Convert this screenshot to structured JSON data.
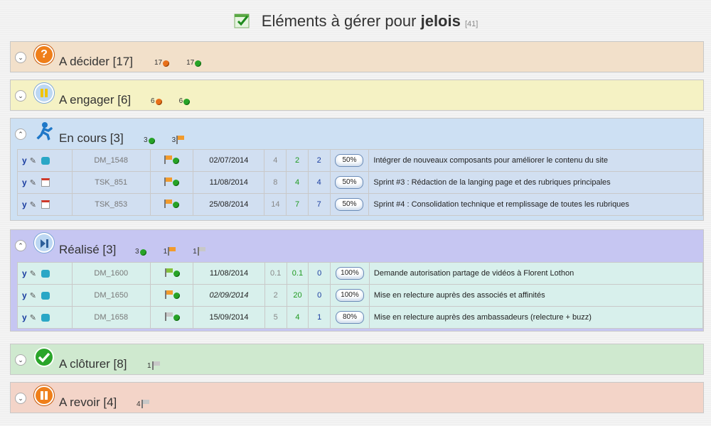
{
  "title": {
    "prefix": "Eléments à gérer pour",
    "user": "jelois",
    "count": "[41]"
  },
  "colors": {
    "decider": "#f2e0ca",
    "engager": "#f5f2c4",
    "encours": "#cde0f3",
    "realise": "#c6c6f2",
    "cloturer": "#cfe9cf",
    "revoir": "#f3d4c8"
  },
  "sections": {
    "decider": {
      "label": "A décider [17]",
      "badges": [
        "17",
        "17"
      ]
    },
    "engager": {
      "label": "A engager [6]",
      "badges": [
        "6",
        "6"
      ]
    },
    "encours": {
      "label": "En cours [3]",
      "badges": [
        "3",
        "3"
      ],
      "rows": [
        {
          "code": "DM_1548",
          "flag": "orange",
          "date": "02/07/2014",
          "n1": "4",
          "n2": "2",
          "n3": "2",
          "pct": "50%",
          "desc": "Intégrer de nouveaux composants pour améliorer le contenu du site",
          "icon3": "cube"
        },
        {
          "code": "TSK_851",
          "flag": "orange",
          "date": "11/08/2014",
          "n1": "8",
          "n2": "4",
          "n3": "4",
          "pct": "50%",
          "desc": "Sprint #3 : Rédaction de la langing page et des rubriques principales",
          "icon3": "calendar"
        },
        {
          "code": "TSK_853",
          "flag": "orange",
          "date": "25/08/2014",
          "n1": "14",
          "n2": "7",
          "n3": "7",
          "pct": "50%",
          "desc": "Sprint #4 : Consolidation technique et remplissage de toutes les rubriques",
          "icon3": "calendar"
        }
      ]
    },
    "realise": {
      "label": "Réalisé [3]",
      "badges": [
        "3",
        "1",
        "1"
      ],
      "rows": [
        {
          "code": "DM_1600",
          "flag": "green",
          "date": "11/08/2014",
          "n1": "0.1",
          "n2": "0.1",
          "n3": "0",
          "pct": "100%",
          "desc": "Demande autorisation partage de vidéos à Florent Lothon",
          "icon3": "cube"
        },
        {
          "code": "DM_1650",
          "flag": "orange",
          "date": "02/09/2014",
          "n1": "2",
          "n2": "20",
          "n3": "0",
          "pct": "100%",
          "desc": "Mise en relecture auprès des associés et affinités",
          "icon3": "cube"
        },
        {
          "code": "DM_1658",
          "flag": "grey",
          "date": "15/09/2014",
          "n1": "5",
          "n2": "4",
          "n3": "1",
          "pct": "80%",
          "desc": "Mise en relecture auprès des ambassadeurs (relecture + buzz)",
          "icon3": "cube"
        }
      ]
    },
    "cloturer": {
      "label": "A clôturer [8]",
      "badges": [
        "1"
      ]
    },
    "revoir": {
      "label": "A revoir [4]",
      "badges": [
        "4"
      ]
    }
  },
  "icons": {
    "toggle_collapsed": "chevron-down",
    "toggle_expanded": "chevron-up",
    "tool1": "y",
    "tool2": "b"
  }
}
